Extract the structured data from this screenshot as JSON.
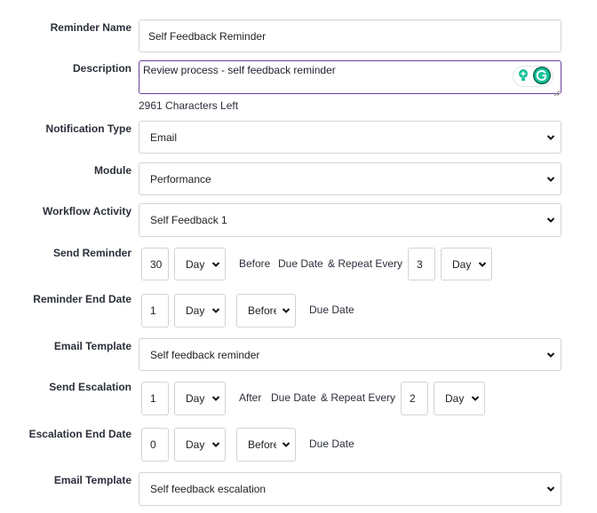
{
  "labels": {
    "reminder_name": "Reminder Name",
    "description": "Description",
    "notification_type": "Notification Type",
    "module": "Module",
    "workflow_activity": "Workflow Activity",
    "send_reminder": "Send Reminder",
    "reminder_end_date": "Reminder End Date",
    "email_template_1": "Email Template",
    "send_escalation": "Send Escalation",
    "escalation_end_date": "Escalation End Date",
    "email_template_2": "Email Template"
  },
  "reminder_name": {
    "value": "Self Feedback Reminder"
  },
  "description": {
    "value": "Review process - self feedback reminder",
    "chars_left": "2961 Characters Left"
  },
  "notification_type": {
    "selected": "Email"
  },
  "module": {
    "selected": "Performance"
  },
  "workflow_activity": {
    "selected": "Self Feedback 1"
  },
  "send_reminder": {
    "count": "30",
    "unit": "Day",
    "before_text": "Before",
    "due_text": "Due Date",
    "repeat_text": "& Repeat Every",
    "repeat_count": "3",
    "repeat_unit": "Day"
  },
  "reminder_end_date": {
    "count": "1",
    "unit": "Day",
    "when": "Before",
    "due_text": "Due Date"
  },
  "email_template_1": {
    "selected": "Self feedback reminder"
  },
  "send_escalation": {
    "count": "1",
    "unit": "Day",
    "after_text": "After",
    "due_text": "Due Date",
    "repeat_text": "& Repeat Every",
    "repeat_count": "2",
    "repeat_unit": "Day"
  },
  "escalation_end_date": {
    "count": "0",
    "unit": "Day",
    "when": "Before",
    "due_text": "Due Date"
  },
  "email_template_2": {
    "selected": "Self feedback escalation"
  },
  "colors": {
    "accent_border": "#6b3fa0",
    "grammarly_green": "#15c39a",
    "grammarly_dark": "#0b6b4e"
  },
  "icons": {
    "grammarly": "grammarly-icon",
    "bulb": "lightbulb-icon",
    "caret": "chevron-down-icon"
  }
}
